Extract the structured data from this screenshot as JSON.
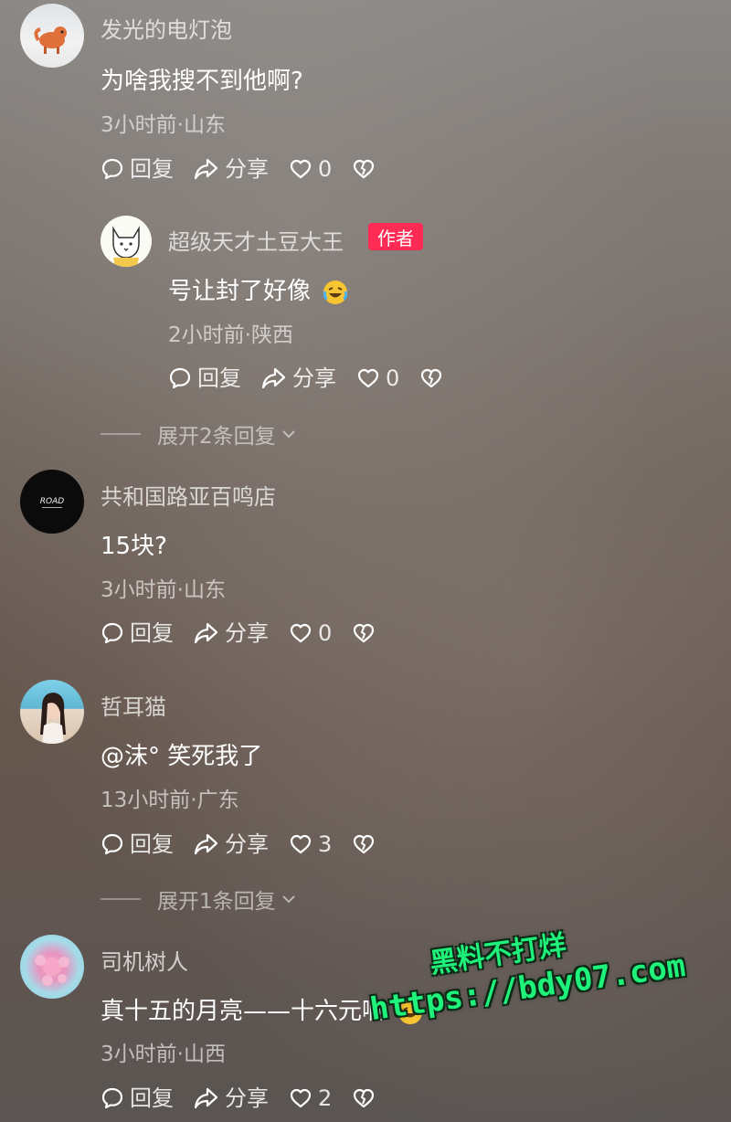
{
  "comments": [
    {
      "username": "发光的电灯泡",
      "text": "为啥我搜不到他啊?",
      "meta": "3小时前·山东",
      "reply_label": "回复",
      "share_label": "分享",
      "likes": "0"
    },
    {
      "username": "共和国路亚百鸣店",
      "text": "15块?",
      "meta": "3小时前·山东",
      "reply_label": "回复",
      "share_label": "分享",
      "likes": "0"
    },
    {
      "username": "哲耳猫",
      "text": "@沫° 笑死我了",
      "meta": "13小时前·广东",
      "reply_label": "回复",
      "share_label": "分享",
      "likes": "3"
    },
    {
      "username": "司机树人",
      "text": "真十五的月亮——十六元啊",
      "meta": "3小时前·山西",
      "reply_label": "回复",
      "share_label": "分享",
      "likes": "2"
    }
  ],
  "reply": {
    "username": "超级天才土豆大王",
    "author_badge": "作者",
    "text": "号让封了好像",
    "meta": "2小时前·陕西",
    "reply_label": "回复",
    "share_label": "分享",
    "likes": "0"
  },
  "expand_replies": [
    {
      "label": "展开2条回复"
    },
    {
      "label": "展开1条回复"
    }
  ],
  "watermark": {
    "line1": "黑料不打烊",
    "line2": "https://bdy07.com"
  },
  "colors": {
    "author_badge": "#fe2c55",
    "watermark": "#1ef27a"
  }
}
